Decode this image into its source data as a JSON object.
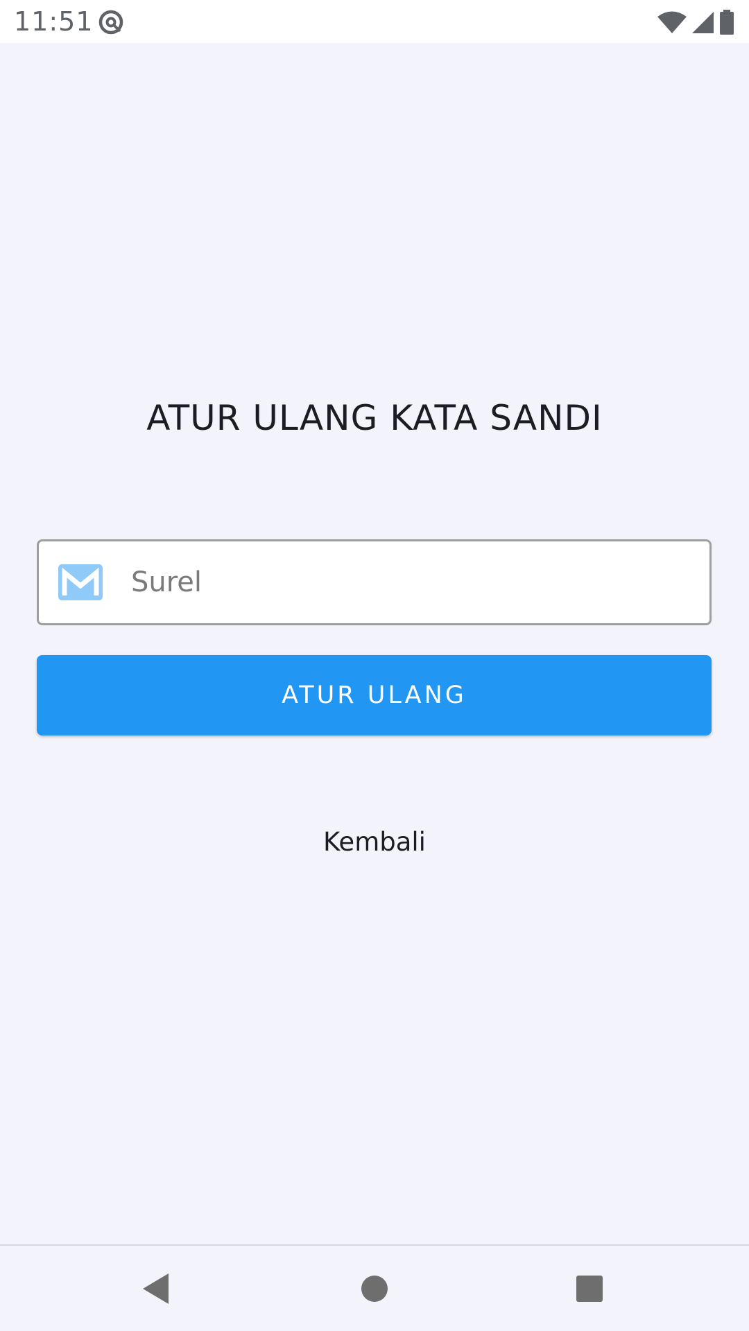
{
  "status_bar": {
    "time": "11:51",
    "icons": [
      "data-saver-icon",
      "wifi-icon",
      "cell-signal-icon",
      "battery-icon"
    ]
  },
  "main": {
    "title": "ATUR ULANG KATA SANDI",
    "email_field": {
      "placeholder": "Surel",
      "value": "",
      "icon": "email-icon"
    },
    "reset_button_label": "ATUR ULANG",
    "back_link_label": "Kembali"
  },
  "nav_bar": {
    "buttons": [
      "back-icon",
      "home-icon",
      "recents-icon"
    ]
  },
  "colors": {
    "background": "#F3F3FC",
    "accent": "#2196F3",
    "email_icon": "#90CAF9",
    "text": "#1C1C24"
  }
}
